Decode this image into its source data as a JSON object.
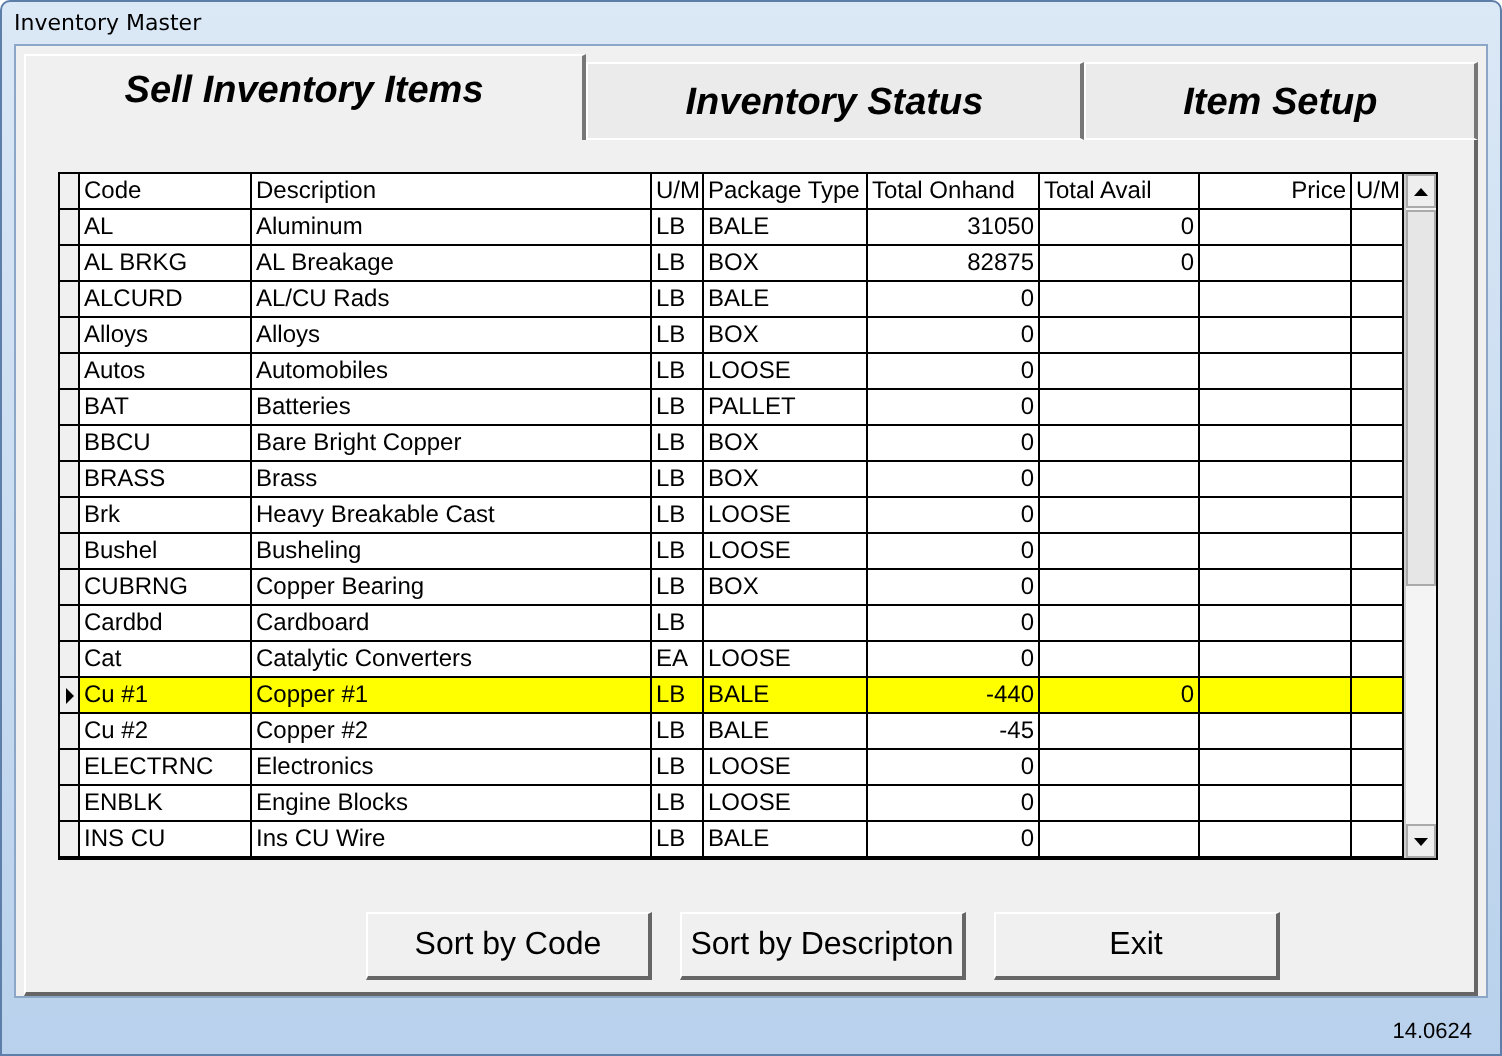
{
  "window": {
    "title": "Inventory Master"
  },
  "tabs": [
    {
      "label": "Sell Inventory Items",
      "selected": true
    },
    {
      "label": "Inventory Status",
      "selected": false
    },
    {
      "label": "Item Setup",
      "selected": false
    }
  ],
  "table": {
    "columns": [
      "Code",
      "Description",
      "U/M",
      "Package Type",
      "Total Onhand",
      "Total Avail",
      "Price",
      "U/M"
    ],
    "rows": [
      {
        "cells": [
          "AL",
          "Aluminum",
          "LB",
          "BALE",
          "31050",
          "0",
          "",
          ""
        ],
        "selected": false
      },
      {
        "cells": [
          "AL BRKG",
          "AL Breakage",
          "LB",
          "BOX",
          "82875",
          "0",
          "",
          ""
        ],
        "selected": false
      },
      {
        "cells": [
          "ALCURD",
          "AL/CU Rads",
          "LB",
          "BALE",
          "0",
          "",
          "",
          ""
        ],
        "selected": false
      },
      {
        "cells": [
          "Alloys",
          "Alloys",
          "LB",
          "BOX",
          "0",
          "",
          "",
          ""
        ],
        "selected": false
      },
      {
        "cells": [
          "Autos",
          "Automobiles",
          "LB",
          "LOOSE",
          "0",
          "",
          "",
          ""
        ],
        "selected": false
      },
      {
        "cells": [
          "BAT",
          "Batteries",
          "LB",
          "PALLET",
          "0",
          "",
          "",
          ""
        ],
        "selected": false
      },
      {
        "cells": [
          "BBCU",
          "Bare Bright Copper",
          "LB",
          "BOX",
          "0",
          "",
          "",
          ""
        ],
        "selected": false
      },
      {
        "cells": [
          "BRASS",
          "Brass",
          "LB",
          "BOX",
          "0",
          "",
          "",
          ""
        ],
        "selected": false
      },
      {
        "cells": [
          "Brk",
          "Heavy Breakable Cast",
          "LB",
          "LOOSE",
          "0",
          "",
          "",
          ""
        ],
        "selected": false
      },
      {
        "cells": [
          "Bushel",
          "Busheling",
          "LB",
          "LOOSE",
          "0",
          "",
          "",
          ""
        ],
        "selected": false
      },
      {
        "cells": [
          "CUBRNG",
          "Copper Bearing",
          "LB",
          "BOX",
          "0",
          "",
          "",
          ""
        ],
        "selected": false
      },
      {
        "cells": [
          "Cardbd",
          "Cardboard",
          "LB",
          "",
          "0",
          "",
          "",
          ""
        ],
        "selected": false
      },
      {
        "cells": [
          "Cat",
          "Catalytic Converters",
          "EA",
          "LOOSE",
          "0",
          "",
          "",
          ""
        ],
        "selected": false
      },
      {
        "cells": [
          "Cu #1",
          "Copper #1",
          "LB",
          "BALE",
          "-440",
          "0",
          "",
          ""
        ],
        "selected": true
      },
      {
        "cells": [
          "Cu #2",
          "Copper #2",
          "LB",
          "BALE",
          "-45",
          "",
          "",
          ""
        ],
        "selected": false
      },
      {
        "cells": [
          "ELECTRNC",
          "Electronics",
          "LB",
          "LOOSE",
          "0",
          "",
          "",
          ""
        ],
        "selected": false
      },
      {
        "cells": [
          "ENBLK",
          "Engine Blocks",
          "LB",
          "LOOSE",
          "0",
          "",
          "",
          ""
        ],
        "selected": false
      },
      {
        "cells": [
          "INS CU",
          "Ins CU Wire",
          "LB",
          "BALE",
          "0",
          "",
          "",
          ""
        ],
        "selected": false
      }
    ]
  },
  "buttons": [
    "Sort by Code",
    "Sort by Descripton",
    "Exit"
  ],
  "status_bar": {
    "version": "14.0624"
  }
}
